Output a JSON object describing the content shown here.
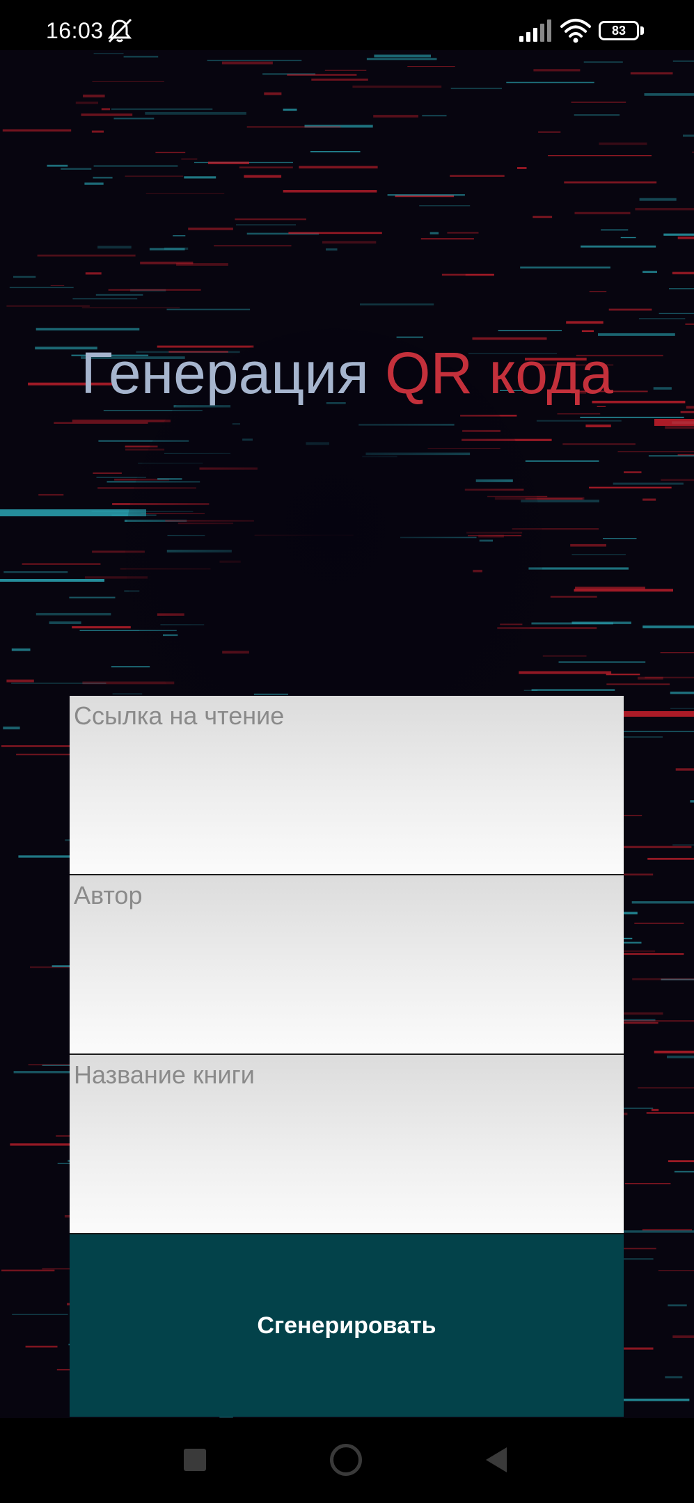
{
  "status_bar": {
    "time": "16:03",
    "battery_level": "83",
    "icons": [
      "bell-off-icon",
      "signal-icon",
      "wifi-icon",
      "battery-icon"
    ]
  },
  "title": {
    "part1": "Генерация",
    "part2": "QR кода"
  },
  "form": {
    "fields": [
      {
        "label": "Ссылка на чтение",
        "value": ""
      },
      {
        "label": "Автор",
        "value": ""
      },
      {
        "label": "Название книги",
        "value": ""
      }
    ],
    "generate_label": "Сгенерировать"
  },
  "nav_bar": {
    "icons": [
      "recent-apps-icon",
      "home-icon",
      "back-icon"
    ]
  },
  "colors": {
    "background": "#05030f",
    "title_primary": "#a6b5ce",
    "title_accent": "#c4303b",
    "button": "#03424a",
    "glitch_red": "#c8202c",
    "glitch_teal": "#2aa6b4"
  }
}
